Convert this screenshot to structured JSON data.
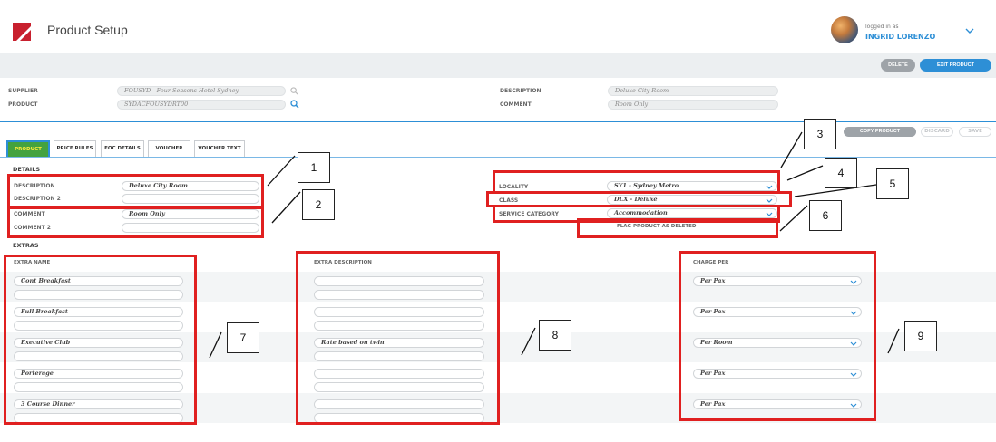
{
  "app": {
    "title": "Product Setup"
  },
  "user": {
    "logged_in_label": "logged in as",
    "name": "INGRID LORENZO"
  },
  "actions": {
    "delete": "DELETE",
    "exit_product": "EXIT PRODUCT",
    "copy_product": "COPY PRODUCT",
    "discard": "DISCARD",
    "save": "SAVE"
  },
  "header_fields": {
    "supplier_label": "SUPPLIER",
    "supplier_value": "FOUSYD - Four Seasons Hotel Sydney",
    "product_label": "PRODUCT",
    "product_value": "SYDACFOUSYDRT00",
    "description_label": "DESCRIPTION",
    "description_value": "Deluxe City Room",
    "comment_label": "COMMENT",
    "comment_value": "Room Only"
  },
  "tabs": [
    {
      "label": "PRODUCT",
      "active": true
    },
    {
      "label": "PRICE RULES"
    },
    {
      "label": "FOC DETAILS"
    },
    {
      "label": "VOUCHER"
    },
    {
      "label": "VOUCHER TEXT"
    }
  ],
  "details": {
    "section_title": "DETAILS",
    "description_label": "DESCRIPTION",
    "description_value": "Deluxe City Room",
    "description2_label": "DESCRIPTION 2",
    "description2_value": "",
    "comment_label": "COMMENT",
    "comment_value": "Room Only",
    "comment2_label": "COMMENT 2",
    "comment2_value": "",
    "locality_label": "LOCALITY",
    "locality_value": "SY1 - Sydney Metro",
    "class_label": "CLASS",
    "class_value": "DLX - Deluxe",
    "service_category_label": "SERVICE CATEGORY",
    "service_category_value": "Accommodation",
    "flag_deleted": "FLAG PRODUCT AS DELETED"
  },
  "extras": {
    "section_title": "EXTRAS",
    "col_name": "EXTRA NAME",
    "col_description": "EXTRA DESCRIPTION",
    "col_charge": "CHARGE PER",
    "rows": [
      {
        "name": "Cont Breakfast",
        "description": "",
        "charge_per": "Per Pax"
      },
      {
        "name": "Full Breakfast",
        "description": "",
        "charge_per": "Per Pax"
      },
      {
        "name": "Executive Club",
        "description": "Rate based on twin",
        "charge_per": "Per Room"
      },
      {
        "name": "Porterage",
        "description": "",
        "charge_per": "Per Pax"
      },
      {
        "name": "3 Course Dinner",
        "description": "",
        "charge_per": "Per Pax"
      }
    ]
  },
  "callouts": [
    "1",
    "2",
    "3",
    "4",
    "5",
    "6",
    "7",
    "8",
    "9"
  ],
  "icons": [
    "logo-icon",
    "search-icon",
    "chevron-down-icon"
  ],
  "colors": {
    "accent": "#2d8fd6",
    "tab_active": "#44a23f",
    "annotation": "#e02020"
  }
}
